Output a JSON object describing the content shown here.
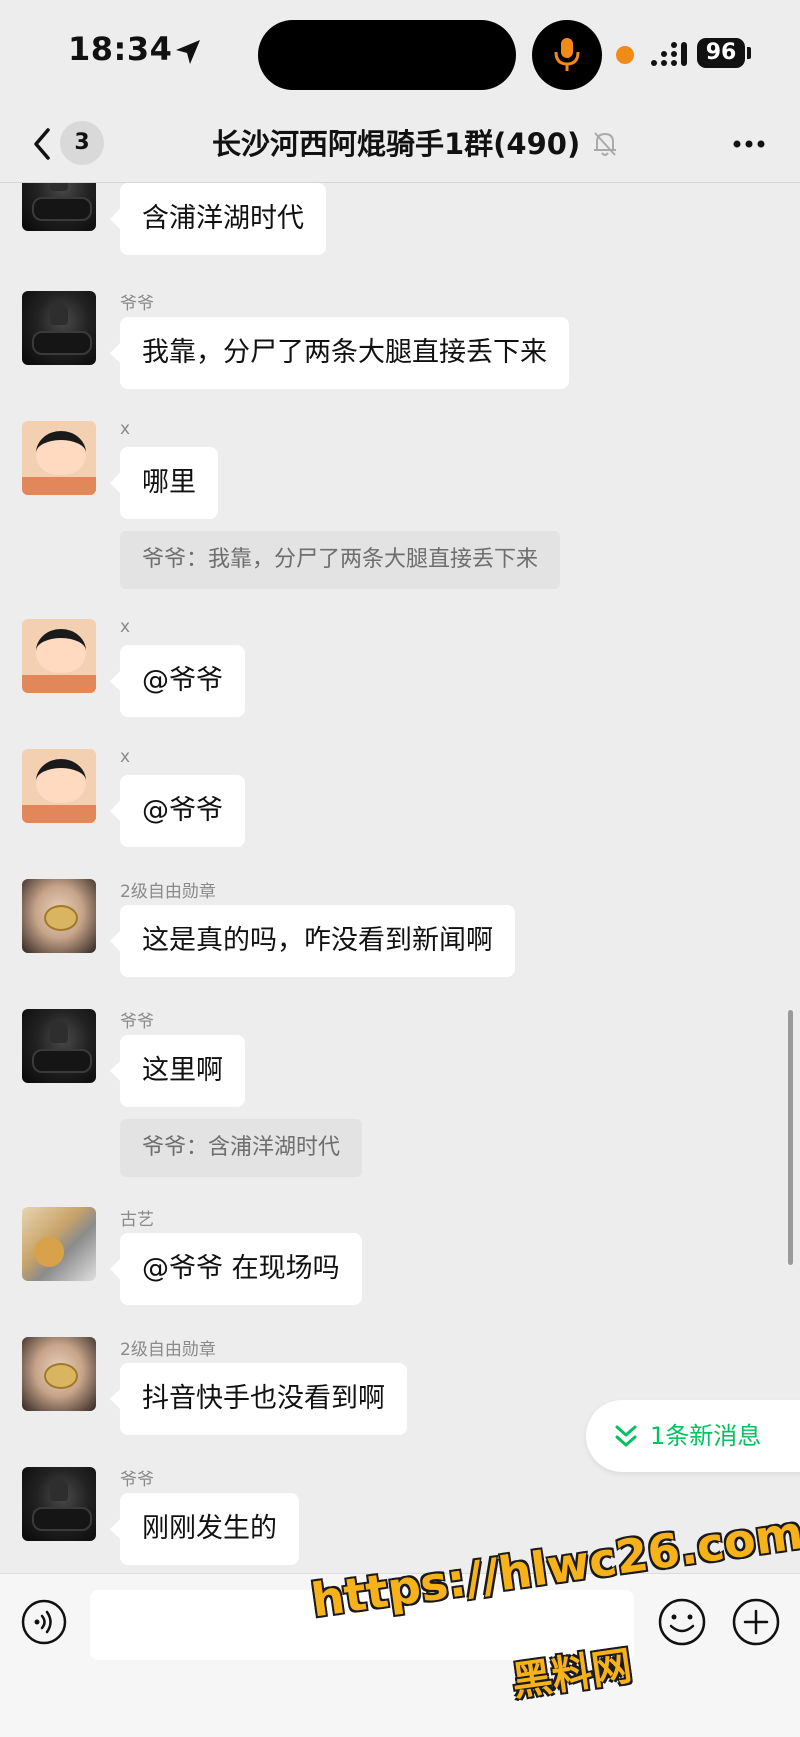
{
  "status_bar": {
    "time": "18:34",
    "battery": "96"
  },
  "header": {
    "back_count": "3",
    "title": "长沙河西阿焜骑手1群(490)"
  },
  "messages": [
    {
      "sender": "",
      "text": "含浦洋湖时代",
      "avatar": "rider-icon"
    },
    {
      "sender": "爷爷",
      "text": "我靠，分尸了两条大腿直接丢下来",
      "avatar": "rider-icon"
    },
    {
      "sender": "x",
      "text": "哪里",
      "quote": "爷爷：我靠，分尸了两条大腿直接丢下来",
      "avatar": "cartoon-icon"
    },
    {
      "sender": "x",
      "text": "@爷爷",
      "avatar": "cartoon-icon"
    },
    {
      "sender": "x",
      "text": "@爷爷",
      "avatar": "cartoon-icon"
    },
    {
      "sender": "2级自由勋章",
      "text": "这是真的吗，咋没看到新闻啊",
      "avatar": "ring-icon"
    },
    {
      "sender": "爷爷",
      "text": "这里啊",
      "quote": "爷爷：含浦洋湖时代",
      "avatar": "rider-icon"
    },
    {
      "sender": "古艺",
      "text": "@爷爷 在现场吗",
      "avatar": "cat-icon"
    },
    {
      "sender": "2级自由勋章",
      "text": "抖音快手也没看到啊",
      "avatar": "ring-icon"
    },
    {
      "sender": "爷爷",
      "text": "刚刚发生的",
      "avatar": "rider-icon"
    }
  ],
  "new_messages_label": "1条新消息",
  "watermark": {
    "url": "https://hlwc26.com",
    "name": "黑料网"
  },
  "colors": {
    "background": "#ededed",
    "bubble": "#ffffff",
    "accent": "#07c160",
    "watermark": "#f7b21a"
  }
}
